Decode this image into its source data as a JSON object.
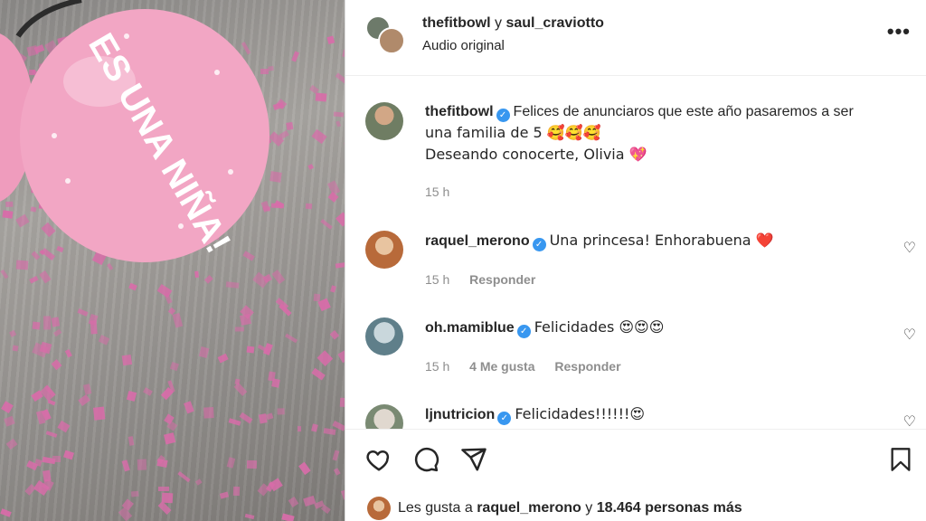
{
  "post": {
    "author": "thefitbowl",
    "connector": "y",
    "coauthor": "saul_craviotto",
    "audio": "Audio original",
    "more_icon": "more-horizontal-icon"
  },
  "caption": {
    "user": "thefitbowl",
    "line1": "Felices de anunciaros que este año pasaremos a ser",
    "line2": "una familia de 5 🥰🥰🥰",
    "line3": "Deseando conocerte, Olivia 💖",
    "time": "15 h"
  },
  "comments": [
    {
      "user": "raquel_merono",
      "text": "Una princesa! Enhorabuena ❤️",
      "time": "15 h",
      "likes": "",
      "reply": "Responder"
    },
    {
      "user": "oh.mamiblue",
      "text": "Felicidades 😍😍😍",
      "time": "15 h",
      "likes": "4 Me gusta",
      "reply": "Responder"
    },
    {
      "user": "ljnutricion",
      "text": "Felicidades!!!!!!😍",
      "time": "",
      "likes": "",
      "reply": ""
    }
  ],
  "media": {
    "balloon_text": "ES UNA NIÑA!"
  },
  "likes_line": {
    "prefix": "Les gusta a",
    "user": "raquel_merono",
    "connector": "y",
    "count": "18.464 personas más"
  },
  "colors": {
    "verified": "#3897f0",
    "balloon": "#f2a6c4",
    "confetti": "#d86ca9"
  }
}
